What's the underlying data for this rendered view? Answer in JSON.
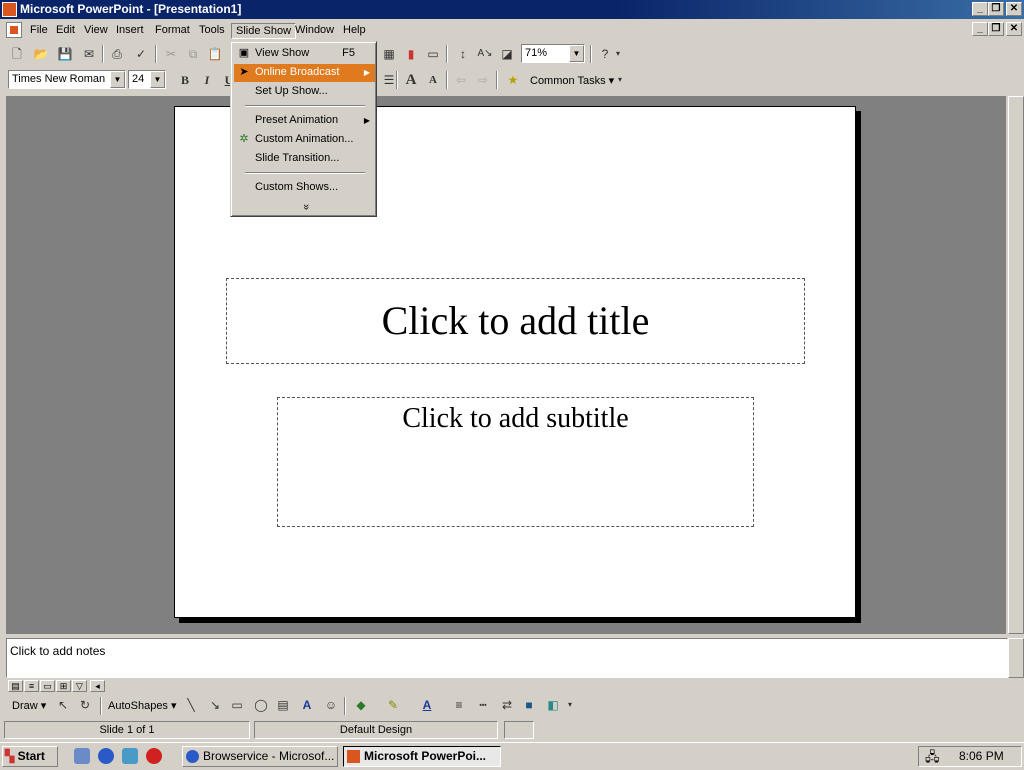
{
  "window": {
    "title": "Microsoft PowerPoint - [Presentation1]",
    "minimize": "_",
    "restore": "❐",
    "close": "✕"
  },
  "menubar": {
    "items": [
      "File",
      "Edit",
      "View",
      "Insert",
      "Format",
      "Tools",
      "Slide Show",
      "Window",
      "Help"
    ]
  },
  "standard_toolbar": {
    "zoom": "71%"
  },
  "formatting_toolbar": {
    "font": "Times New Roman",
    "font_size": "24",
    "bold": "B",
    "italic": "I",
    "underline": "U",
    "common_tasks": "Common Tasks ▾"
  },
  "slideshow_menu": {
    "items": [
      {
        "label": "View Show",
        "shortcut": "F5"
      },
      {
        "label": "Online Broadcast"
      },
      {
        "label": "Set Up Show..."
      },
      {
        "label": "Preset Animation"
      },
      {
        "label": "Custom Animation..."
      },
      {
        "label": "Slide Transition..."
      },
      {
        "label": "Custom Shows..."
      }
    ],
    "expand": "»"
  },
  "slide": {
    "title_placeholder": "Click to add title",
    "subtitle_placeholder": "Click to add subtitle"
  },
  "notes": {
    "placeholder": "Click to add notes"
  },
  "drawing_toolbar": {
    "draw": "Draw ▾",
    "autoshapes": "AutoShapes ▾"
  },
  "statusbar": {
    "slide": "Slide 1 of 1",
    "design": "Default Design"
  },
  "taskbar": {
    "start": "Start",
    "tasks": [
      "Browservice - Microsof...",
      "Microsoft PowerPoi..."
    ],
    "clock": "8:06 PM"
  },
  "colors": {
    "title_bar": "#0a246a",
    "menu_highlight": "#e07a1f",
    "face": "#d4d0c8",
    "workspace": "#808080"
  }
}
